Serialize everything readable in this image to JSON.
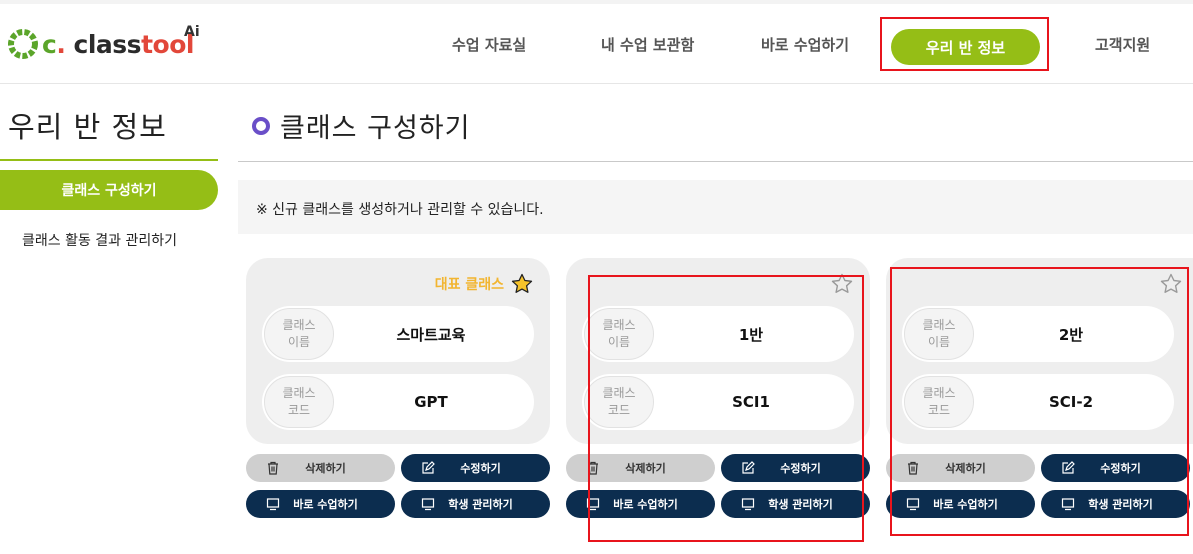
{
  "header": {
    "logo_parts": [
      "c",
      ". ",
      "class",
      "tool"
    ],
    "logo_ai": "Ai",
    "nav": [
      {
        "label": "수업 자료실"
      },
      {
        "label": "내 수업 보관함"
      },
      {
        "label": "바로 수업하기"
      },
      {
        "label": "우리 반 정보",
        "active": true
      },
      {
        "label": "고객지원"
      }
    ]
  },
  "sidebar": {
    "title": "우리 반 정보",
    "items": [
      {
        "label": "클래스 구성하기",
        "active": true
      },
      {
        "label": "클래스 활동 결과 관리하기"
      }
    ]
  },
  "main": {
    "title": "클래스 구성하기",
    "notice": "※  신규 클래스를 생성하거나 관리할 수 있습니다.",
    "representative_label": "대표 클래스",
    "field_labels": {
      "name": "클래스\n이름",
      "code": "클래스\n코드"
    },
    "buttons": {
      "delete": "삭제하기",
      "edit": "수정하기",
      "start": "바로 수업하기",
      "students": "학생 관리하기"
    },
    "classes": [
      {
        "name": "스마트교육",
        "code": "GPT",
        "representative": true
      },
      {
        "name": "1반",
        "code": "SCI1",
        "representative": false
      },
      {
        "name": "2반",
        "code": "SCI-2",
        "representative": false
      }
    ]
  },
  "colors": {
    "accent_green": "#95be16",
    "navy": "#0c2d4f",
    "star_gold": "#f2b530",
    "annotation_red": "#e8141c",
    "bullet_purple": "#6a4fc8"
  }
}
